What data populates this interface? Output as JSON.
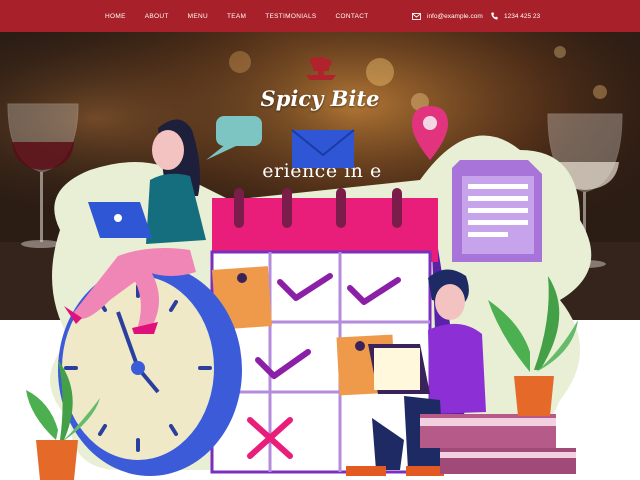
{
  "nav": {
    "items": [
      "HOME",
      "ABOUT",
      "MENU",
      "TEAM",
      "TESTIMONIALS",
      "CONTACT"
    ]
  },
  "contact": {
    "email": "info@example.com",
    "phone": "1234 425 23"
  },
  "brand": {
    "name": "Spicy Bite"
  },
  "hero": {
    "tagline": "erience in e"
  },
  "icons": {
    "email": "envelope-icon",
    "phone": "phone-icon",
    "logo": "chef-hat-logo-icon"
  },
  "colors": {
    "topbar": "#a8202a",
    "calendar_header": "#e91e7a",
    "check": "#8b1fa8",
    "cross": "#e91e7a",
    "clock_rim": "#3b5bd9",
    "leaf": "#4caf50"
  }
}
